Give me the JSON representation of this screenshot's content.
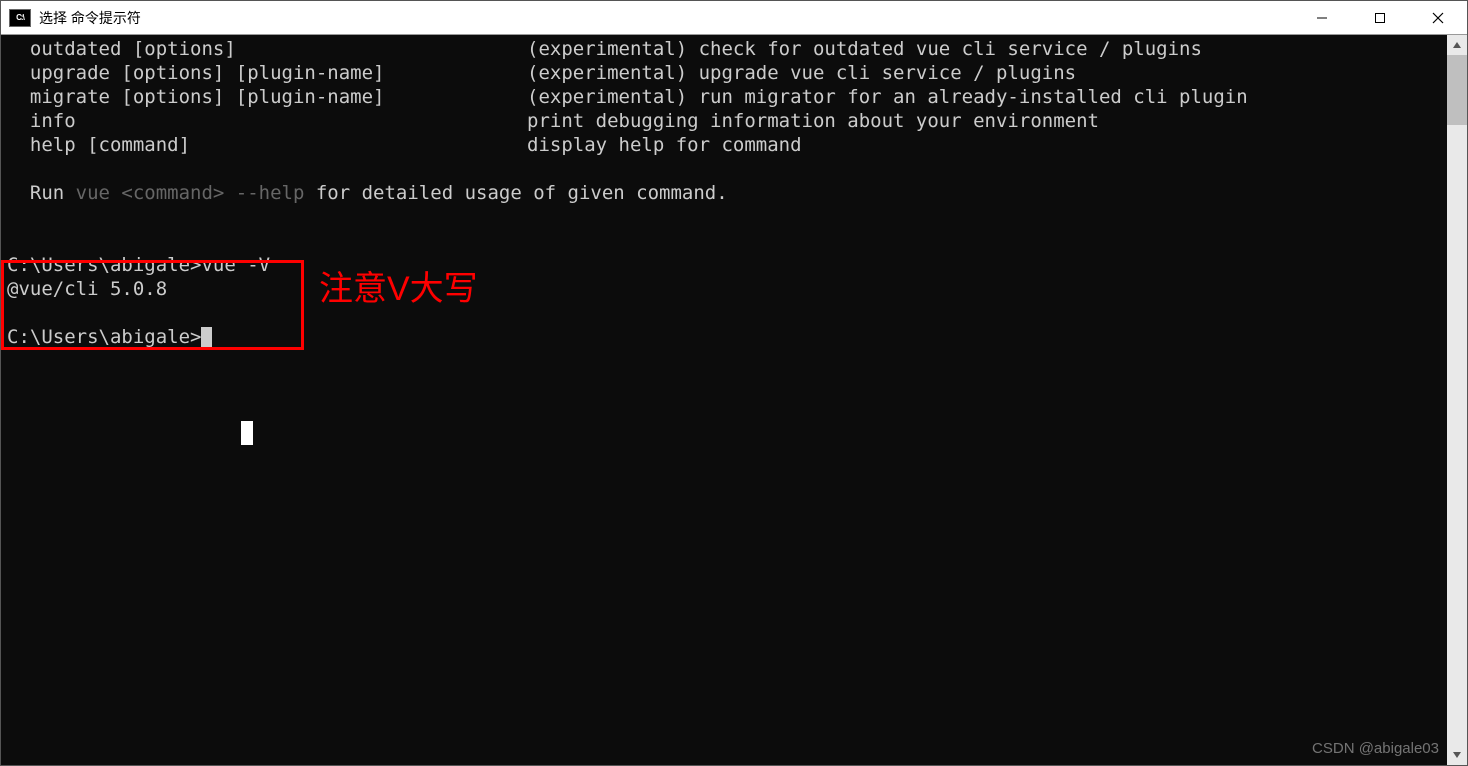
{
  "window": {
    "icon_label": "C:\\",
    "title": "选择 命令提示符"
  },
  "help": {
    "commands": [
      {
        "cmd": "outdated [options]",
        "desc": "(experimental) check for outdated vue cli service / plugins"
      },
      {
        "cmd": "upgrade [options] [plugin-name]",
        "desc": "(experimental) upgrade vue cli service / plugins"
      },
      {
        "cmd": "migrate [options] [plugin-name]",
        "desc": "(experimental) run migrator for an already-installed cli plugin"
      },
      {
        "cmd": "info",
        "desc": "print debugging information about your environment"
      },
      {
        "cmd": "help [command]",
        "desc": "display help for command"
      }
    ],
    "footer_prefix": "  Run ",
    "footer_link": "vue <command> --help",
    "footer_suffix": " for detailed usage of given command."
  },
  "session": {
    "prompt1": "C:\\Users\\abigale>",
    "cmd1": "vue -V",
    "out1": "@vue/cli 5.0.8",
    "prompt2": "C:\\Users\\abigale>"
  },
  "annotation": "注意V大写",
  "watermark": "CSDN @abigale03"
}
